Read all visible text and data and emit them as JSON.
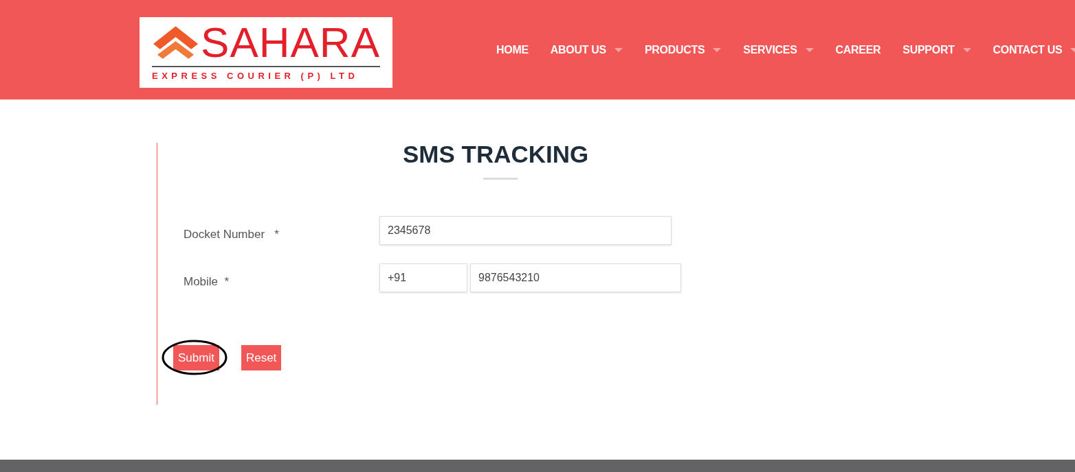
{
  "logo": {
    "name": "SAHARA",
    "tagline": "EXPRESS COURIER (P) LTD"
  },
  "nav": [
    {
      "label": "HOME",
      "dropdown": false
    },
    {
      "label": "ABOUT US",
      "dropdown": true
    },
    {
      "label": "PRODUCTS",
      "dropdown": true
    },
    {
      "label": "SERVICES",
      "dropdown": true
    },
    {
      "label": "CAREER",
      "dropdown": false
    },
    {
      "label": "SUPPORT",
      "dropdown": true
    },
    {
      "label": "CONTACT US",
      "dropdown": true
    }
  ],
  "title": "SMS TRACKING",
  "form": {
    "docket": {
      "label": "Docket Number",
      "required": "*",
      "value": "2345678"
    },
    "mobile": {
      "label": "Mobile",
      "required": "*",
      "code": "+91",
      "value": "9876543210"
    }
  },
  "buttons": [
    {
      "label": "Submit",
      "circled": true
    },
    {
      "label": "Reset",
      "circled": false
    }
  ]
}
